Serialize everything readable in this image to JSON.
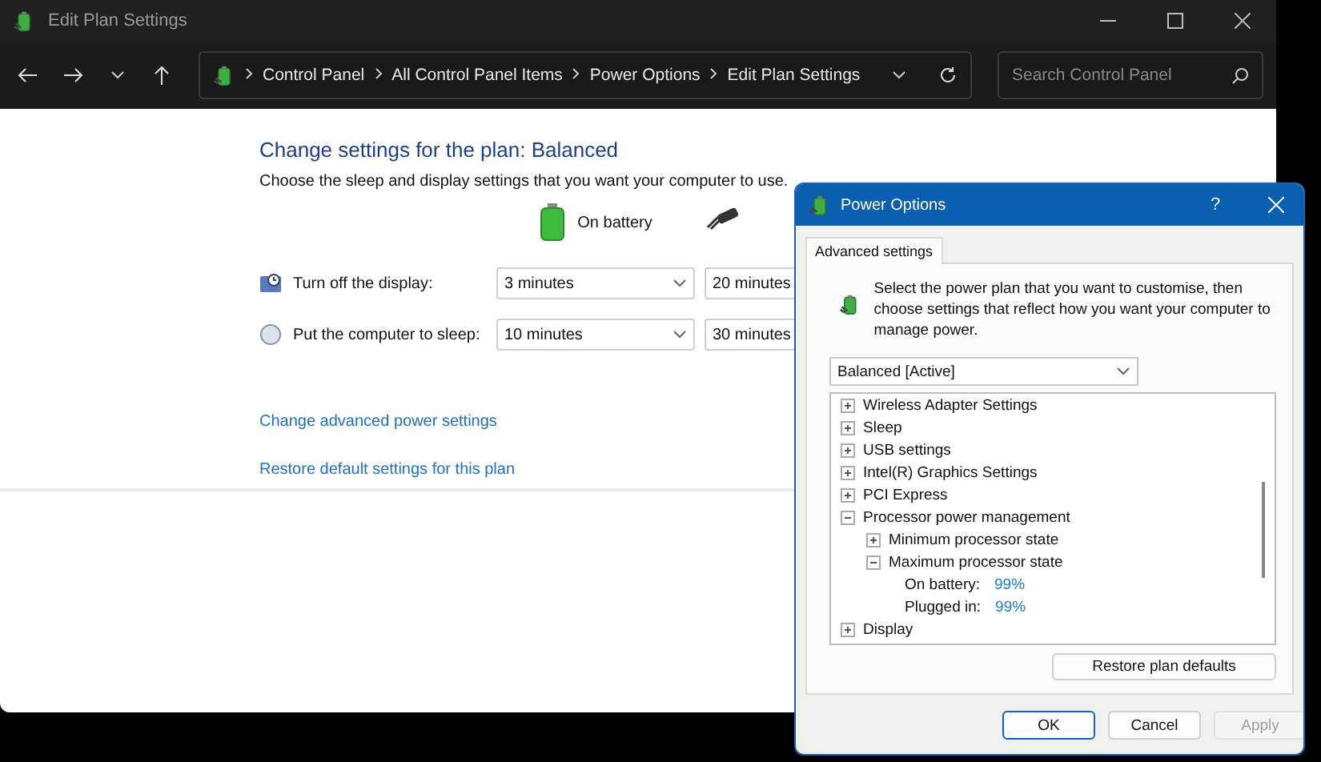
{
  "main_window": {
    "title": "Edit Plan Settings",
    "breadcrumb": [
      "Control Panel",
      "All Control Panel Items",
      "Power Options",
      "Edit Plan Settings"
    ],
    "search": {
      "placeholder": "Search Control Panel"
    },
    "heading": "Change settings for the plan: Balanced",
    "subheading": "Choose the sleep and display settings that you want your computer to use.",
    "column_header": "On battery",
    "settings": [
      {
        "kind": "display",
        "label": "Turn off the display:",
        "on_battery": "3 minutes",
        "plugged_in": "20 minutes"
      },
      {
        "kind": "sleep",
        "label": "Put the computer to sleep:",
        "on_battery": "10 minutes",
        "plugged_in": "30 minutes"
      }
    ],
    "links": [
      "Change advanced power settings",
      "Restore default settings for this plan"
    ]
  },
  "dialog": {
    "title": "Power Options",
    "help_button": "?",
    "tabs": [
      {
        "label": "Advanced settings",
        "selected": true
      }
    ],
    "description": "Select the power plan that you want to customise, then choose settings that reflect how you want your computer to manage power.",
    "plan_select": "Balanced [Active]",
    "tree": [
      {
        "label": "Wireless Adapter Settings",
        "expanded": false
      },
      {
        "label": "Sleep",
        "expanded": false
      },
      {
        "label": "USB settings",
        "expanded": false
      },
      {
        "label": "Intel(R) Graphics Settings",
        "expanded": false
      },
      {
        "label": "PCI Express",
        "expanded": false
      },
      {
        "label": "Processor power management",
        "expanded": true,
        "children": [
          {
            "label": "Minimum processor state",
            "expanded": false
          },
          {
            "label": "Maximum processor state",
            "expanded": true,
            "children": [
              {
                "label": "On battery:",
                "value": "99%"
              },
              {
                "label": "Plugged in:",
                "value": "99%"
              }
            ]
          }
        ]
      },
      {
        "label": "Display",
        "expanded": false
      }
    ],
    "restore_button": "Restore plan defaults",
    "buttons": [
      {
        "label": "OK",
        "default": true,
        "disabled": false
      },
      {
        "label": "Cancel",
        "default": false,
        "disabled": false
      },
      {
        "label": "Apply",
        "default": false,
        "disabled": true
      }
    ]
  }
}
